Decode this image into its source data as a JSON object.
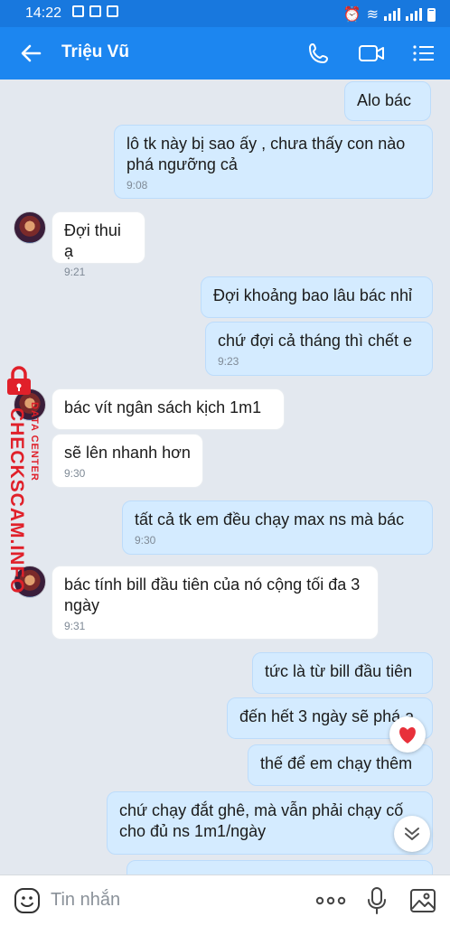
{
  "status": {
    "time": "14:22"
  },
  "header": {
    "contact_name": "Triệu Vũ"
  },
  "messages": [
    {
      "text": "Alo bác",
      "time": ""
    },
    {
      "text": "lô tk này bị sao ấy , chưa thấy con nào phá ngưỡng cả",
      "time": "9:08"
    },
    {
      "text": "Đợi thui ạ",
      "time": "9:21"
    },
    {
      "text": "Đợi khoảng bao lâu bác nhỉ",
      "time": ""
    },
    {
      "text": "chứ đợi cả tháng thì chết e",
      "time": "9:23"
    },
    {
      "text": "bác vít ngân sách kịch 1m1",
      "time": ""
    },
    {
      "text": "sẽ lên nhanh hơn",
      "time": "9:30"
    },
    {
      "text": "tất cả tk em đều chạy max ns mà bác",
      "time": "9:30"
    },
    {
      "text": "bác tính bill đầu tiên của nó cộng tối đa 3 ngày",
      "time": "9:31"
    },
    {
      "text": "tức là từ bill đầu tiên",
      "time": ""
    },
    {
      "text": "đến hết 3 ngày sẽ phá ạ",
      "time": ""
    },
    {
      "text": "thế để em chạy thêm",
      "time": ""
    },
    {
      "text": "chứ chạy đắt ghê, mà vẫn phải chạy cố cho đủ ns 1m1/ngày",
      "time": ""
    }
  ],
  "watermark": {
    "main": "CHECKSCAM.INFO",
    "sub": "DATA CENTER"
  },
  "input": {
    "placeholder": "Tin nhắn"
  },
  "colors": {
    "header": "#1c86f0",
    "statusbar": "#1878de",
    "bubble_me": "#d4ebff",
    "bubble_them": "#ffffff",
    "background": "#e3e8ef"
  }
}
